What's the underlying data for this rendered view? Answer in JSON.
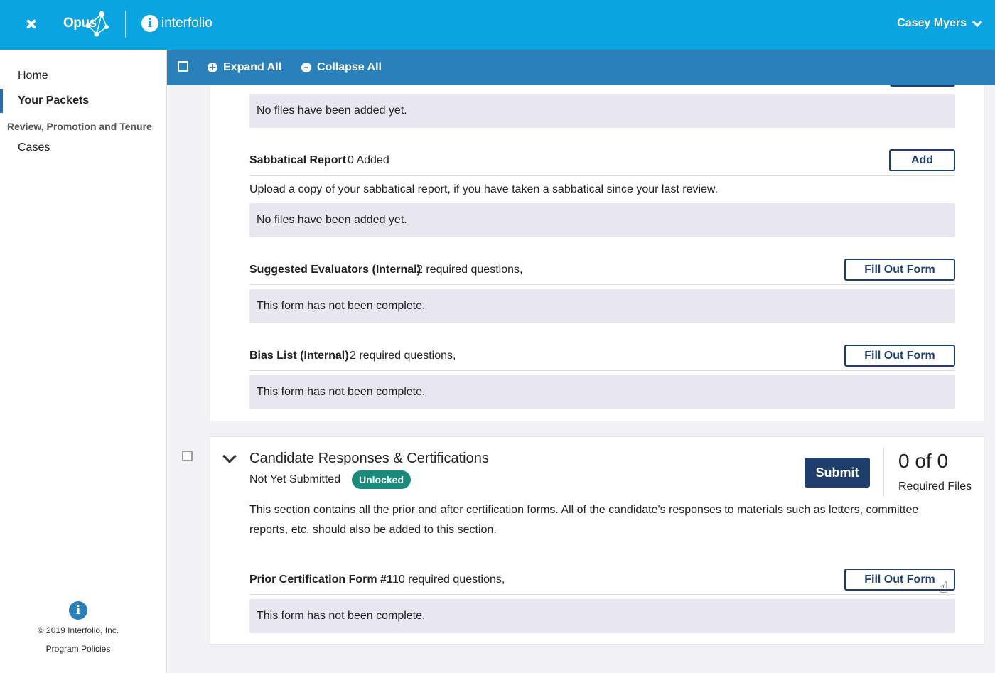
{
  "header": {
    "brand_opus": "Opus",
    "brand_interfolio": "interfolio",
    "user_name": "Casey Myers"
  },
  "sidebar": {
    "items": [
      {
        "label": "Home"
      },
      {
        "label": "Your Packets",
        "active": true
      }
    ],
    "group_label": "Review, Promotion and Tenure",
    "group_items": [
      {
        "label": "Cases"
      }
    ],
    "footer": {
      "copyright": "© 2019 Interfolio, Inc.",
      "policies": "Program Policies"
    }
  },
  "toolbar": {
    "expand_all": "Expand All",
    "collapse_all": "Collapse All"
  },
  "top_section": {
    "first_empty_message": "No files have been added yet.",
    "items": [
      {
        "title": "Sabbatical Report",
        "meta": "0 Added",
        "button": "Add",
        "description": "Upload a copy of your sabbatical report, if you have taken a sabbatical since your last review.",
        "status": "No files have been added yet."
      },
      {
        "title": "Suggested Evaluators (Internal)",
        "meta": "2 required questions,",
        "button": "Fill Out Form",
        "status": "This form has not been complete."
      },
      {
        "title": "Bias List (Internal)",
        "meta": "2 required questions,",
        "button": "Fill Out Form",
        "status": "This form has not been complete."
      }
    ]
  },
  "candidate_section": {
    "title": "Candidate Responses & Certifications",
    "status": "Not Yet Submitted",
    "badge": "Unlocked",
    "submit": "Submit",
    "count": "0 of 0",
    "count_label": "Required Files",
    "description_line1": "This section contains all the prior and after certification forms. All of the candidate's responses to materials such as letters, committee",
    "description_line2": "reports, etc. should also be added to this section.",
    "items": [
      {
        "title": "Prior Certification Form #1",
        "meta": "10 required questions,",
        "button": "Fill Out Form",
        "status": "This form has not been complete."
      }
    ]
  },
  "colors": {
    "header_bg": "#0aa4e0",
    "toolbar_bg": "#2a80b9",
    "primary_button": "#1e3f6b",
    "badge_unlocked": "#1a8a7a",
    "panel_gray": "#e8e6ef"
  }
}
